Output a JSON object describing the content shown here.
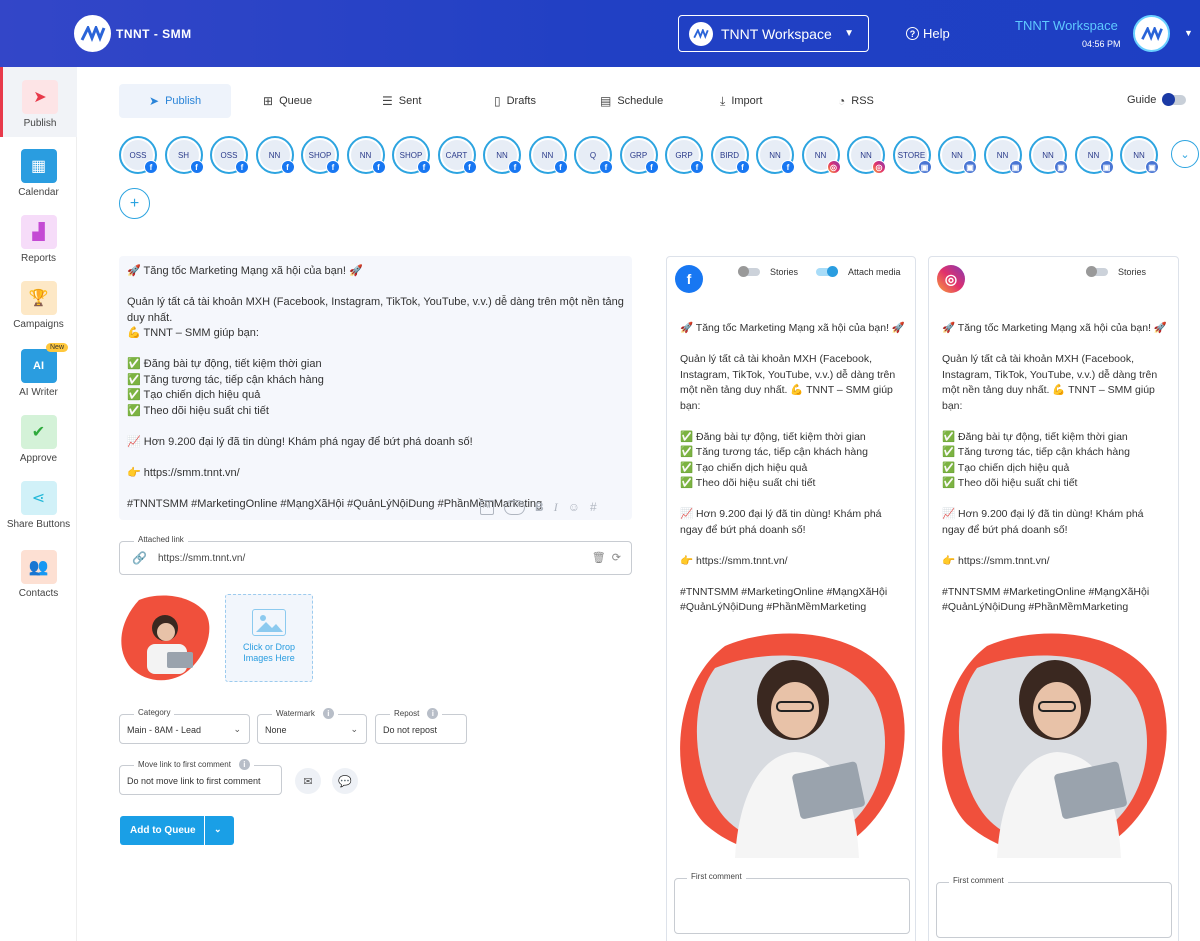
{
  "header": {
    "brand": "TNNT - SMM",
    "workspace": "TNNT Workspace",
    "help": "Help",
    "user_name": "TNNT Workspace",
    "time": "04:56 PM"
  },
  "sidebar": {
    "items": [
      {
        "label": "Publish",
        "icon": "paper-plane-icon",
        "color": "#e8394a"
      },
      {
        "label": "Calendar",
        "icon": "calendar-icon",
        "color": "#2a9de0"
      },
      {
        "label": "Reports",
        "icon": "bar-chart-icon",
        "color": "#c44ad4"
      },
      {
        "label": "Campaigns",
        "icon": "trophy-icon",
        "color": "#f1a21e"
      },
      {
        "label": "AI Writer",
        "icon": "ai-pen-icon",
        "color": "#2a9de0",
        "badge": "New"
      },
      {
        "label": "Approve",
        "icon": "approve-chart-icon",
        "color": "#2eaa3c"
      },
      {
        "label": "Share Buttons",
        "icon": "share-icon",
        "color": "#22b8d8"
      },
      {
        "label": "Contacts",
        "icon": "people-icon",
        "color": "#f0743e"
      }
    ]
  },
  "tabs": [
    {
      "label": "Publish",
      "icon": "paper-plane-icon"
    },
    {
      "label": "Queue",
      "icon": "queue-plus-icon"
    },
    {
      "label": "Sent",
      "icon": "list-icon"
    },
    {
      "label": "Drafts",
      "icon": "document-icon"
    },
    {
      "label": "Schedule",
      "icon": "calendar-clock-icon"
    },
    {
      "label": "Import",
      "icon": "import-icon"
    },
    {
      "label": "RSS",
      "icon": "rss-icon"
    }
  ],
  "guide": {
    "label": "Guide",
    "enabled": true
  },
  "accounts": [
    {
      "net": "fb",
      "initials": "OSS"
    },
    {
      "net": "fb",
      "initials": "SH"
    },
    {
      "net": "fb",
      "initials": "OSS"
    },
    {
      "net": "fb",
      "initials": "NN"
    },
    {
      "net": "fb",
      "initials": "SHOP"
    },
    {
      "net": "fb",
      "initials": "NN"
    },
    {
      "net": "fb",
      "initials": "SHOP"
    },
    {
      "net": "fb",
      "initials": "CART"
    },
    {
      "net": "fb",
      "initials": "NN"
    },
    {
      "net": "fb",
      "initials": "NN"
    },
    {
      "net": "fb",
      "initials": "Q"
    },
    {
      "net": "fb",
      "initials": "GRP"
    },
    {
      "net": "fb",
      "initials": "GRP"
    },
    {
      "net": "fb",
      "initials": "BIRD"
    },
    {
      "net": "fb",
      "initials": "NN"
    },
    {
      "net": "ig",
      "initials": "NN"
    },
    {
      "net": "ig",
      "initials": "NN"
    },
    {
      "net": "gb",
      "initials": "STORE"
    },
    {
      "net": "gb",
      "initials": "NN"
    },
    {
      "net": "gb",
      "initials": "NN"
    },
    {
      "net": "gb",
      "initials": "NN"
    },
    {
      "net": "gb",
      "initials": "NN"
    },
    {
      "net": "gb",
      "initials": "NN"
    }
  ],
  "editor": {
    "lines": [
      "🚀 Tăng tốc Marketing Mạng xã hội của bạn! 🚀",
      "",
      "Quản lý tất cả tài khoản MXH (Facebook, Instagram, TikTok, YouTube, v.v.) dễ dàng trên một nền tảng duy nhất.",
      "💪 TNNT – SMM giúp bạn:",
      "",
      "✅ Đăng bài tự động, tiết kiệm thời gian",
      "✅ Tăng tương tác, tiếp cận khách hàng",
      "✅ Tạo chiến dịch hiệu quả",
      "✅ Theo dõi hiệu suất chi tiết",
      "",
      "📈 Hơn 9.200 đại lý đã tin dùng! Khám phá ngay để bứt phá doanh số!",
      "",
      "👉 https://smm.tnnt.vn/",
      "",
      "#TNNTSMM #MarketingOnline #MạngXãHội #QuảnLýNộiDung #PhầnMềmMarketing"
    ],
    "tools": [
      "AI",
      "CTA",
      "B",
      "I",
      "☺",
      "#"
    ]
  },
  "attached_link": {
    "label": "Attached link",
    "url": "https://smm.tnnt.vn/"
  },
  "drop_zone": {
    "text": "Click or Drop Images Here"
  },
  "category": {
    "label": "Category",
    "value": "Main - 8AM - Lead"
  },
  "watermark": {
    "label": "Watermark",
    "value": "None"
  },
  "repost": {
    "label": "Repost",
    "value": "Do not repost"
  },
  "move_link": {
    "label": "Move link to first comment",
    "value": "Do not move link to first comment"
  },
  "add_button": {
    "label": "Add to Queue"
  },
  "preview_fb": {
    "stories": "Stories",
    "attach_media": "Attach media",
    "lines": [
      "🚀 Tăng tốc Marketing Mạng xã hội của bạn! 🚀",
      "",
      "Quản lý tất cả tài khoản MXH (Facebook, Instagram, TikTok, YouTube, v.v.) dễ dàng trên một nền tảng duy nhất. 💪 TNNT – SMM giúp bạn:",
      "",
      "✅ Đăng bài tự động, tiết kiệm thời gian",
      "✅ Tăng tương tác, tiếp cận khách hàng",
      "✅ Tạo chiến dịch hiệu quả",
      "✅ Theo dõi hiệu suất chi tiết",
      "",
      "📈 Hơn 9.200 đại lý đã tin dùng! Khám phá ngay để bứt phá doanh số!",
      "",
      "👉 https://smm.tnnt.vn/",
      "",
      "#TNNTSMM #MarketingOnline #MạngXãHội #QuảnLýNộiDung #PhầnMềmMarketing"
    ],
    "first_comment": "First comment"
  },
  "preview_ig": {
    "stories": "Stories",
    "lines": [
      "🚀 Tăng tốc Marketing Mạng xã hội của bạn! 🚀",
      "",
      "Quản lý tất cả tài khoản MXH (Facebook, Instagram, TikTok, YouTube, v.v.) dễ dàng trên một nền tảng duy nhất. 💪 TNNT – SMM giúp bạn:",
      "",
      "✅ Đăng bài tự động, tiết kiệm thời gian",
      "✅ Tăng tương tác, tiếp cận khách hàng",
      "✅ Tạo chiến dịch hiệu quả",
      "✅ Theo dõi hiệu suất chi tiết",
      "",
      "📈 Hơn 9.200 đại lý đã tin dùng! Khám phá ngay để bứt phá doanh số!",
      "",
      "👉 https://smm.tnnt.vn/",
      "",
      "#TNNTSMM #MarketingOnline #MạngXãHội #QuảnLýNộiDung #PhầnMềmMarketing"
    ],
    "first_comment": "First comment"
  },
  "colors": {
    "primary": "#1a9fe6",
    "header": "#2140c4",
    "accent": "#e8394a"
  }
}
